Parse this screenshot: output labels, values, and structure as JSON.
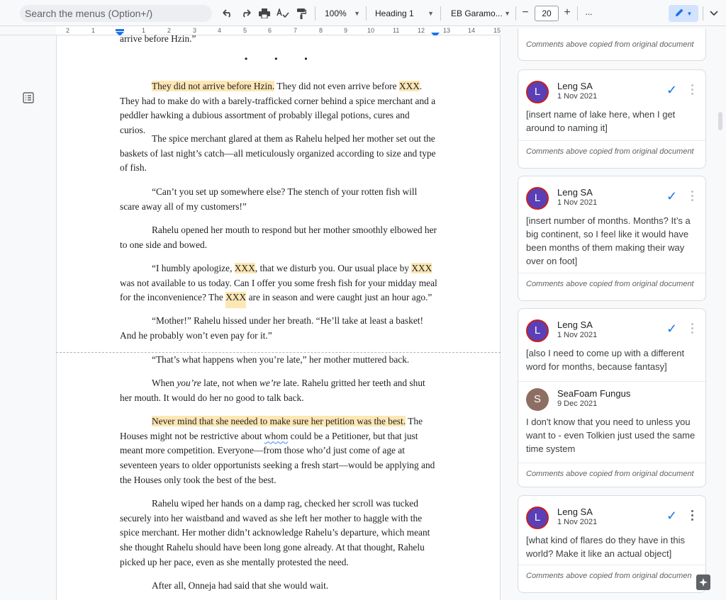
{
  "toolbar": {
    "search_menus": "Search the menus (Option+/)",
    "zoom": "100%",
    "style": "Heading 1",
    "font": "EB Garamo...",
    "font_size": "20",
    "minus": "−",
    "plus": "+",
    "more": "···"
  },
  "ruler": {
    "labels": [
      "2",
      "1",
      "1",
      "2",
      "3",
      "4",
      "5",
      "6",
      "7",
      "8",
      "9",
      "10",
      "11",
      "12",
      "13",
      "14",
      "15"
    ]
  },
  "document": {
    "top_fragment": "arrive before Hzin.”",
    "p1_hl": "They did not arrive before Hzin.",
    "p1_a": " They did not even arrive before ",
    "p1_xxx": "XXX",
    "p1_b": ". They had to make do with a barely-trafficked corner behind a spice merchant and a peddler hawking a dubious assortment of probably illegal potions, cures and curios.",
    "p2": "The spice merchant glared at them as Rahelu helped her mother set out the baskets of last night’s catch—all meticulously organized according to size and type of fish.",
    "p3": "“Can’t you set up somewhere else? The stench of your rotten fish will scare away all of my customers!”",
    "p4": "Rahelu opened her mouth to respond but her mother smoothly elbowed her to one side and bowed.",
    "p5_a": "“I humbly apologize, ",
    "p5_xxx1": "XXX",
    "p5_b": ", that we disturb you. Our usual place by ",
    "p5_xxx2": "XXX",
    "p5_c": " was not available to us today. Can I offer you some fresh fish for your midday meal for the inconvenience? The ",
    "p5_xxx3": "XXX",
    "p5_d": " are in season and were caught just an hour ago.”",
    "p6": "“Mother!” Rahelu hissed under her breath. “He’ll take at least a basket! And he probably won’t even pay for it.”",
    "p7": "“That’s what happens when you’re late,” her mother muttered back.",
    "p8_a": "When ",
    "p8_em1": "you’re",
    "p8_b": " late, not when ",
    "p8_em2": "we’re",
    "p8_c": " late. Rahelu gritted her teeth and shut her mouth. It would do her no good to talk back.",
    "p9_hl": "Never mind that she needed to make sure her petition was the best.",
    "p9_a": " The Houses might not be restrictive about ",
    "p9_whom": "whom",
    "p9_b": " could be a Petitioner, but that just meant more competition. Everyone—from those who’d just come of age at seventeen years to older opportunists seeking a fresh start—would be applying and the Houses only took the best of the best.",
    "p10": "Rahelu wiped her hands on a damp rag, checked her scroll was tucked securely into her waistband and waved as she left her mother to haggle with the spice merchant. Her mother didn’t acknowledge Rahelu’s departure, which meant she thought Rahelu should have been long gone already. At that thought, Rahelu picked up her pace, even as she mentally protested the need.",
    "p11": "After all, Onneja had said that she would wait."
  },
  "comments": {
    "footer": "Comments above copied from original document",
    "footer_truncated": "Comments above copied from original documen",
    "c1": {
      "initial": "L",
      "name": "Leng SA",
      "date": "1 Nov 2021",
      "body": "[insert name of lake here, when I get around to naming it]"
    },
    "c2": {
      "initial": "L",
      "name": "Leng SA",
      "date": "1 Nov 2021",
      "body": "[insert number of months. Months? It’s a big continent, so I feel like it would have been months of them making their way over on foot]"
    },
    "c3": {
      "initial": "L",
      "name": "Leng SA",
      "date": "1 Nov 2021",
      "body": "[also I need to come up with a different word for months, because fantasy]"
    },
    "c3_reply": {
      "initial": "S",
      "name": "SeaFoam Fungus",
      "date": "9 Dec 2021",
      "body": "I don't know that you need to unless you want to - even Tolkien just used the same time system"
    },
    "c4": {
      "initial": "L",
      "name": "Leng SA",
      "date": "1 Nov 2021",
      "body": "[what kind of flares do they have in this world? Make it like an actual object]"
    }
  },
  "colors": {
    "highlight": "#fde7b4",
    "accent": "#1a73e8",
    "avatar_l": "#5a3fb6",
    "avatar_s": "#8d6e63"
  }
}
